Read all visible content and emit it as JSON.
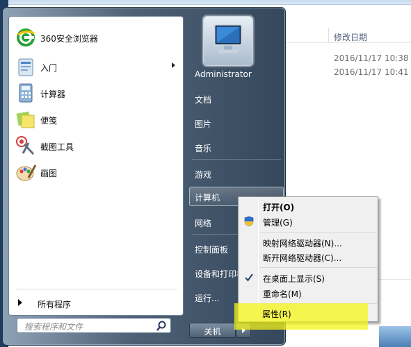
{
  "explorer": {
    "column_header": "修改日期",
    "dates": [
      "2016/11/17 10:38",
      "2016/11/17 10:41"
    ]
  },
  "start_menu": {
    "programs": [
      {
        "label": "360安全浏览器",
        "icon": "browser-360-icon"
      },
      {
        "label": "入门",
        "icon": "getting-started-icon"
      },
      {
        "label": "计算器",
        "icon": "calculator-icon"
      },
      {
        "label": "便笺",
        "icon": "sticky-notes-icon"
      },
      {
        "label": "截图工具",
        "icon": "snipping-tool-icon"
      },
      {
        "label": "画图",
        "icon": "paint-icon"
      }
    ],
    "all_programs": "所有程序",
    "search_placeholder": "搜索程序和文件",
    "user": "Administrator",
    "right_items": [
      "文档",
      "图片",
      "音乐",
      "游戏",
      "计算机",
      "网络",
      "控制面板",
      "设备和打印机",
      "运行..."
    ],
    "shutdown": "关机"
  },
  "context_menu": {
    "items": [
      {
        "label": "打开(O)",
        "bold": true
      },
      {
        "label": "管理(G)",
        "icon": "uac-shield-icon"
      },
      {
        "label": "映射网络驱动器(N)..."
      },
      {
        "label": "断开网络驱动器(C)..."
      },
      {
        "label": "在桌面上显示(S)",
        "checked": true
      },
      {
        "label": "重命名(M)"
      },
      {
        "label": "属性(R)",
        "highlighted": true
      }
    ],
    "highlight_color": "#f5f519"
  }
}
